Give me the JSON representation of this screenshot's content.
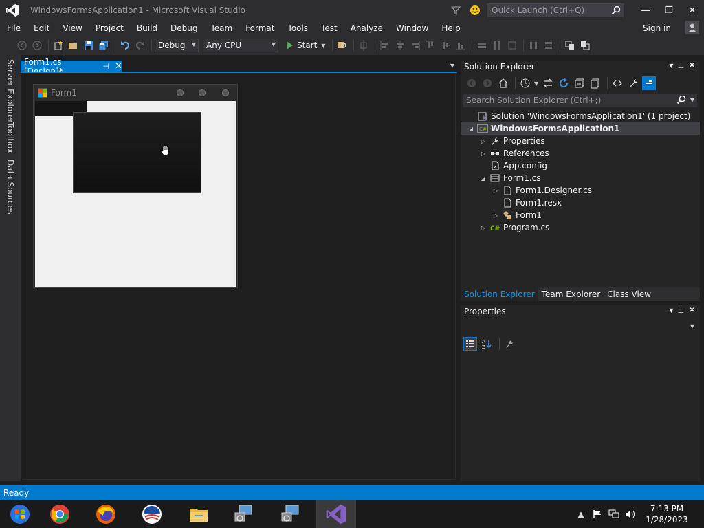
{
  "window": {
    "title": "WindowsFormsApplication1 - Microsoft Visual Studio",
    "quick_launch_placeholder": "Quick Launch (Ctrl+Q)",
    "minimize": "—",
    "restore": "❐",
    "close": "✕"
  },
  "menu": {
    "items": [
      "File",
      "Edit",
      "View",
      "Project",
      "Build",
      "Debug",
      "Team",
      "Format",
      "Tools",
      "Test",
      "Analyze",
      "Window",
      "Help"
    ],
    "sign_in": "Sign in"
  },
  "toolbar": {
    "configuration": "Debug",
    "platform": "Any CPU",
    "start_label": "Start"
  },
  "side_tabs": [
    "Server Explorer",
    "Toolbox",
    "Data Sources"
  ],
  "document": {
    "tab_label": "Form1.cs [Design]*",
    "form_title": "Form1"
  },
  "solution_explorer": {
    "title": "Solution Explorer",
    "search_placeholder": "Search Solution Explorer (Ctrl+;)",
    "tree": [
      {
        "label": "Solution 'WindowsFormsApplication1' (1 project)",
        "level": 0,
        "toggle": "",
        "icon": "solution-icon"
      },
      {
        "label": "WindowsFormsApplication1",
        "level": 0,
        "toggle": "◢",
        "icon": "csharp-project-icon",
        "selected": true
      },
      {
        "label": "Properties",
        "level": 1,
        "toggle": "▷",
        "icon": "wrench-icon"
      },
      {
        "label": "References",
        "level": 1,
        "toggle": "▷",
        "icon": "references-icon"
      },
      {
        "label": "App.config",
        "level": 1,
        "toggle": "",
        "icon": "config-file-icon"
      },
      {
        "label": "Form1.cs",
        "level": 1,
        "toggle": "◢",
        "icon": "form-file-icon"
      },
      {
        "label": "Form1.Designer.cs",
        "level": 2,
        "toggle": "▷",
        "icon": "cs-file-icon"
      },
      {
        "label": "Form1.resx",
        "level": 2,
        "toggle": "",
        "icon": "resx-file-icon"
      },
      {
        "label": "Form1",
        "level": 2,
        "toggle": "▷",
        "icon": "class-icon"
      },
      {
        "label": "Program.cs",
        "level": 1,
        "toggle": "▷",
        "icon": "csharp-file-icon"
      }
    ],
    "tabs": [
      "Solution Explorer",
      "Team Explorer",
      "Class View"
    ]
  },
  "properties": {
    "title": "Properties"
  },
  "status": {
    "text": "Ready"
  },
  "taskbar": {
    "time": "7:13 PM",
    "date": "1/28/2023"
  },
  "colors": {
    "accent": "#007acc",
    "background": "#1e1e1e",
    "chrome": "#2d2d30",
    "vs_purple": "#865fc5"
  }
}
